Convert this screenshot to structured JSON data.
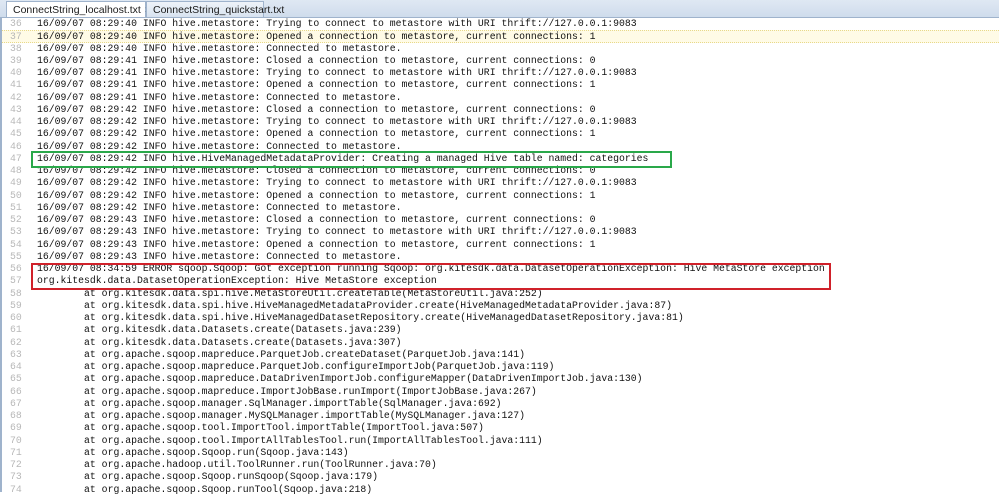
{
  "tabs": [
    {
      "label": "ConnectString_localhost.txt",
      "active": true,
      "close": "×"
    },
    {
      "label": "ConnectString_quickstart.txt",
      "active": false
    }
  ],
  "current_line": 37,
  "highlights": {
    "green_line": 47,
    "red_lines": [
      56,
      57
    ],
    "green_color": "#2aa84a",
    "red_color": "#d0212a"
  },
  "lines": [
    {
      "n": "36",
      "t": "16/09/07 08:29:40 INFO hive.metastore: Trying to connect to metastore with URI thrift://127.0.0.1:9083"
    },
    {
      "n": "37",
      "t": "16/09/07 08:29:40 INFO hive.metastore: Opened a connection to metastore, current connections: 1"
    },
    {
      "n": "38",
      "t": "16/09/07 08:29:40 INFO hive.metastore: Connected to metastore."
    },
    {
      "n": "39",
      "t": "16/09/07 08:29:41 INFO hive.metastore: Closed a connection to metastore, current connections: 0"
    },
    {
      "n": "40",
      "t": "16/09/07 08:29:41 INFO hive.metastore: Trying to connect to metastore with URI thrift://127.0.0.1:9083"
    },
    {
      "n": "41",
      "t": "16/09/07 08:29:41 INFO hive.metastore: Opened a connection to metastore, current connections: 1"
    },
    {
      "n": "42",
      "t": "16/09/07 08:29:41 INFO hive.metastore: Connected to metastore."
    },
    {
      "n": "43",
      "t": "16/09/07 08:29:42 INFO hive.metastore: Closed a connection to metastore, current connections: 0"
    },
    {
      "n": "44",
      "t": "16/09/07 08:29:42 INFO hive.metastore: Trying to connect to metastore with URI thrift://127.0.0.1:9083"
    },
    {
      "n": "45",
      "t": "16/09/07 08:29:42 INFO hive.metastore: Opened a connection to metastore, current connections: 1"
    },
    {
      "n": "46",
      "t": "16/09/07 08:29:42 INFO hive.metastore: Connected to metastore."
    },
    {
      "n": "47",
      "t": "16/09/07 08:29:42 INFO hive.HiveManagedMetadataProvider: Creating a managed Hive table named: categories"
    },
    {
      "n": "48",
      "t": "16/09/07 08:29:42 INFO hive.metastore: Closed a connection to metastore, current connections: 0"
    },
    {
      "n": "49",
      "t": "16/09/07 08:29:42 INFO hive.metastore: Trying to connect to metastore with URI thrift://127.0.0.1:9083"
    },
    {
      "n": "50",
      "t": "16/09/07 08:29:42 INFO hive.metastore: Opened a connection to metastore, current connections: 1"
    },
    {
      "n": "51",
      "t": "16/09/07 08:29:42 INFO hive.metastore: Connected to metastore."
    },
    {
      "n": "52",
      "t": "16/09/07 08:29:43 INFO hive.metastore: Closed a connection to metastore, current connections: 0"
    },
    {
      "n": "53",
      "t": "16/09/07 08:29:43 INFO hive.metastore: Trying to connect to metastore with URI thrift://127.0.0.1:9083"
    },
    {
      "n": "54",
      "t": "16/09/07 08:29:43 INFO hive.metastore: Opened a connection to metastore, current connections: 1"
    },
    {
      "n": "55",
      "t": "16/09/07 08:29:43 INFO hive.metastore: Connected to metastore."
    },
    {
      "n": "56",
      "t": "16/09/07 08:34:59 ERROR sqoop.Sqoop: Got exception running Sqoop: org.kitesdk.data.DatasetOperationException: Hive MetaStore exception"
    },
    {
      "n": "57",
      "t": "org.kitesdk.data.DatasetOperationException: Hive MetaStore exception"
    },
    {
      "n": "58",
      "t": "\tat org.kitesdk.data.spi.hive.MetaStoreUtil.createTable(MetaStoreUtil.java:252)"
    },
    {
      "n": "59",
      "t": "\tat org.kitesdk.data.spi.hive.HiveManagedMetadataProvider.create(HiveManagedMetadataProvider.java:87)"
    },
    {
      "n": "60",
      "t": "\tat org.kitesdk.data.spi.hive.HiveManagedDatasetRepository.create(HiveManagedDatasetRepository.java:81)"
    },
    {
      "n": "61",
      "t": "\tat org.kitesdk.data.Datasets.create(Datasets.java:239)"
    },
    {
      "n": "62",
      "t": "\tat org.kitesdk.data.Datasets.create(Datasets.java:307)"
    },
    {
      "n": "63",
      "t": "\tat org.apache.sqoop.mapreduce.ParquetJob.createDataset(ParquetJob.java:141)"
    },
    {
      "n": "64",
      "t": "\tat org.apache.sqoop.mapreduce.ParquetJob.configureImportJob(ParquetJob.java:119)"
    },
    {
      "n": "65",
      "t": "\tat org.apache.sqoop.mapreduce.DataDrivenImportJob.configureMapper(DataDrivenImportJob.java:130)"
    },
    {
      "n": "66",
      "t": "\tat org.apache.sqoop.mapreduce.ImportJobBase.runImport(ImportJobBase.java:267)"
    },
    {
      "n": "67",
      "t": "\tat org.apache.sqoop.manager.SqlManager.importTable(SqlManager.java:692)"
    },
    {
      "n": "68",
      "t": "\tat org.apache.sqoop.manager.MySQLManager.importTable(MySQLManager.java:127)"
    },
    {
      "n": "69",
      "t": "\tat org.apache.sqoop.tool.ImportTool.importTable(ImportTool.java:507)"
    },
    {
      "n": "70",
      "t": "\tat org.apache.sqoop.tool.ImportAllTablesTool.run(ImportAllTablesTool.java:111)"
    },
    {
      "n": "71",
      "t": "\tat org.apache.sqoop.Sqoop.run(Sqoop.java:143)"
    },
    {
      "n": "72",
      "t": "\tat org.apache.hadoop.util.ToolRunner.run(ToolRunner.java:70)"
    },
    {
      "n": "73",
      "t": "\tat org.apache.sqoop.Sqoop.runSqoop(Sqoop.java:179)"
    },
    {
      "n": "74",
      "t": "\tat org.apache.sqoop.Sqoop.runTool(Sqoop.java:218)"
    }
  ]
}
